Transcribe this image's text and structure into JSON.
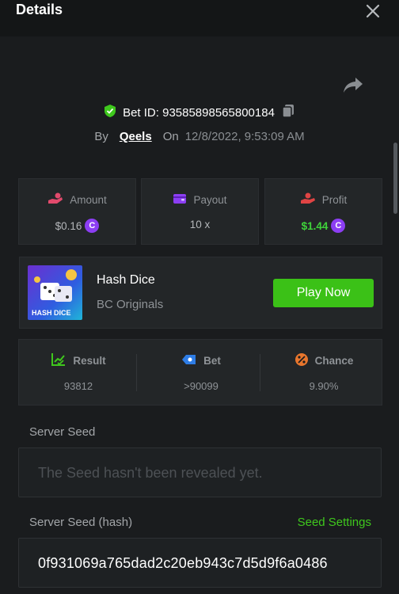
{
  "header": {
    "title": "Details"
  },
  "bet": {
    "id_label": "Bet ID: 935858985658001​84",
    "by_label": "By",
    "user": "Qeels",
    "on_label": "On",
    "datetime": "12/8/2022, 9:53:09 AM"
  },
  "stats": {
    "amount": {
      "label": "Amount",
      "value": "$0.16"
    },
    "payout": {
      "label": "Payout",
      "value": "10 x"
    },
    "profit": {
      "label": "Profit",
      "value": "$1.44"
    }
  },
  "game": {
    "name": "Hash Dice",
    "provider": "BC Originals",
    "thumb_text": "HASH DICE",
    "play_label": "Play Now"
  },
  "result": {
    "result": {
      "label": "Result",
      "value": "93812"
    },
    "bet": {
      "label": "Bet",
      "value": ">90099"
    },
    "chance": {
      "label": "Chance",
      "value": "9.90%"
    }
  },
  "seeds": {
    "server_seed_label": "Server Seed",
    "server_seed_placeholder": "The Seed hasn't been revealed yet.",
    "server_seed_hash_label": "Server Seed (hash)",
    "seed_settings_label": "Seed Settings",
    "server_seed_hash_value": "0f931069a765dad2c20eb943c7d5d9f6a0486"
  },
  "icons": {
    "close": "close-icon",
    "share": "share-icon",
    "shield": "shield-check-icon",
    "copy": "copy-icon",
    "amount": "hand-coin-icon",
    "payout": "wallet-icon",
    "profit": "profit-icon",
    "coin": "coin-icon",
    "result": "chart-check-icon",
    "bet": "tag-icon",
    "chance": "percent-icon"
  },
  "colors": {
    "accent_green": "#3bc117",
    "coin_purple": "#8c3ef3",
    "amount_icon": "#e24a6c",
    "payout_icon": "#8c3ef3",
    "profit_icon": "#e04444",
    "result_icon": "#3fc81d",
    "bet_icon": "#2e7de6",
    "chance_icon": "#e8762d"
  }
}
